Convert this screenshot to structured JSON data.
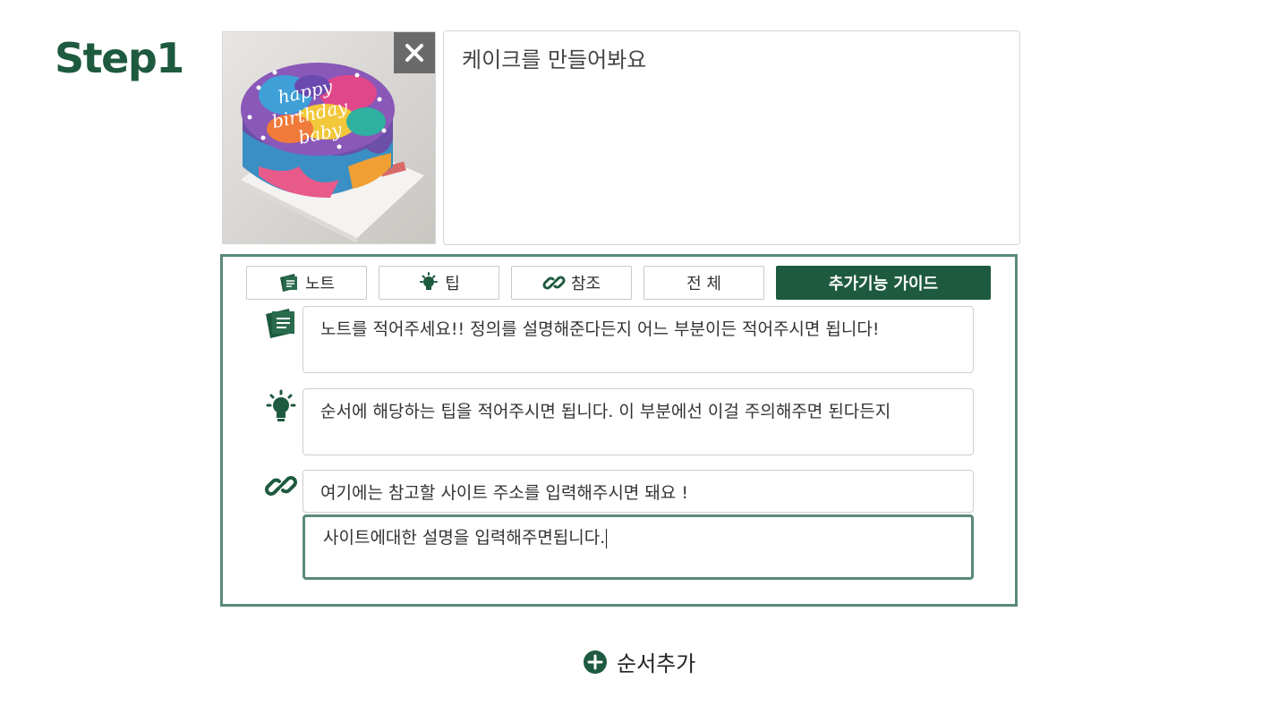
{
  "step": {
    "title": "Step1"
  },
  "photo": {
    "close_label": "×"
  },
  "description": {
    "value": "케이크를 만들어봐요"
  },
  "tabs": [
    {
      "label": "노트",
      "icon": "note-icon"
    },
    {
      "label": "팁",
      "icon": "lightbulb-icon"
    },
    {
      "label": "참조",
      "icon": "link-icon"
    },
    {
      "label": "전 체",
      "icon": ""
    },
    {
      "label": "추가기능 가이드",
      "icon": ""
    }
  ],
  "note": {
    "value": "노트를 적어주세요!! 정의를 설명해준다든지 어느 부분이든 적어주시면 됩니다!"
  },
  "tip": {
    "value": "순서에 해당하는 팁을 적어주시면 됩니다. 이 부분에선 이걸 주의해주면 된다든지"
  },
  "reference": {
    "url_value": "여기에는 참고할 사이트 주소를 입력해주시면 돼요 !",
    "desc_value": "사이트에대한 설명을 입력해주면됩니다."
  },
  "add_step": {
    "label": "순서추가"
  },
  "colors": {
    "accent": "#1e5a3f",
    "panel_border": "#5a8a78"
  }
}
